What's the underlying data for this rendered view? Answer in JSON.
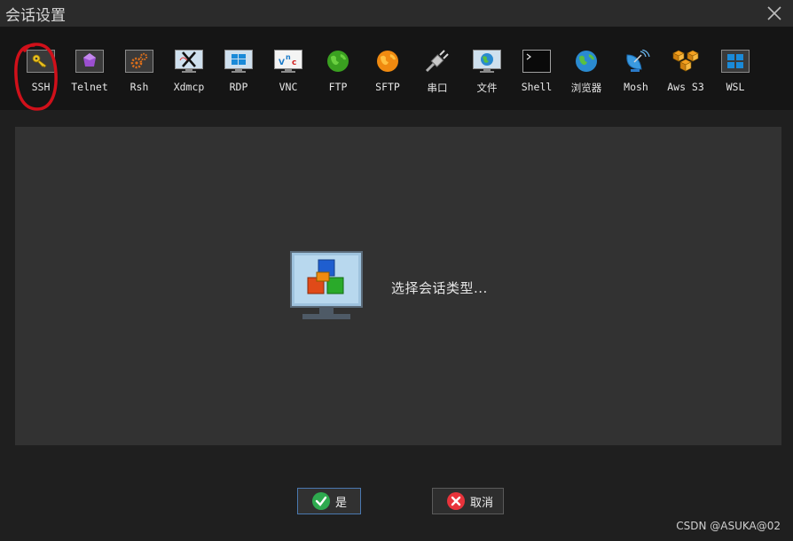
{
  "window": {
    "title": "会话设置",
    "close_icon": "close-icon"
  },
  "toolbar": {
    "items": [
      {
        "id": "ssh",
        "label": "SSH",
        "icon": "key-icon"
      },
      {
        "id": "telnet",
        "label": "Telnet",
        "icon": "gem-icon"
      },
      {
        "id": "rsh",
        "label": "Rsh",
        "icon": "gears-icon"
      },
      {
        "id": "xdmcp",
        "label": "Xdmcp",
        "icon": "x-monitor-icon"
      },
      {
        "id": "rdp",
        "label": "RDP",
        "icon": "windows-monitor-icon"
      },
      {
        "id": "vnc",
        "label": "VNC",
        "icon": "vnc-monitor-icon"
      },
      {
        "id": "ftp",
        "label": "FTP",
        "icon": "green-globe-icon"
      },
      {
        "id": "sftp",
        "label": "SFTP",
        "icon": "orange-globe-icon"
      },
      {
        "id": "serial",
        "label": "串口",
        "icon": "plug-icon"
      },
      {
        "id": "file",
        "label": "文件",
        "icon": "file-monitor-icon"
      },
      {
        "id": "shell",
        "label": "Shell",
        "icon": "terminal-icon"
      },
      {
        "id": "browser",
        "label": "浏览器",
        "icon": "globe-icon"
      },
      {
        "id": "mosh",
        "label": "Mosh",
        "icon": "satellite-dish-icon"
      },
      {
        "id": "awss3",
        "label": "Aws S3",
        "icon": "aws-cubes-icon"
      },
      {
        "id": "wsl",
        "label": "WSL",
        "icon": "windows-logo-icon"
      }
    ],
    "highlight": "ssh"
  },
  "main": {
    "placeholder_text": "选择会话类型...",
    "placeholder_icon": "session-cubes-monitor-icon"
  },
  "buttons": {
    "ok_label": "是",
    "cancel_label": "取消"
  },
  "watermark": "CSDN @ASUKA@02",
  "colors": {
    "toolbar_bg": "#151515",
    "panel_bg": "#323232",
    "highlight_circle": "#d0101a",
    "ok_accent": "#2eaa4f",
    "cancel_accent": "#e8333b"
  }
}
